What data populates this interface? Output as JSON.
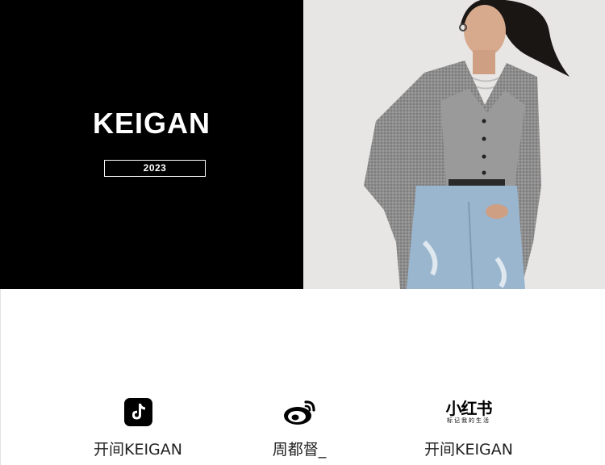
{
  "banner": {
    "brand": "KEIGAN",
    "year": "2023"
  },
  "social": [
    {
      "icon": "douyin-icon",
      "label": "开间KEIGAN"
    },
    {
      "icon": "weibo-icon",
      "label": "周都督_"
    },
    {
      "icon": "xiaohongshu-logo",
      "logo_text": "小红书",
      "logo_subtext": "标记我的生活",
      "label": "开间KEIGAN"
    }
  ],
  "colors": {
    "banner_bg": "#000000",
    "text": "#222222"
  }
}
